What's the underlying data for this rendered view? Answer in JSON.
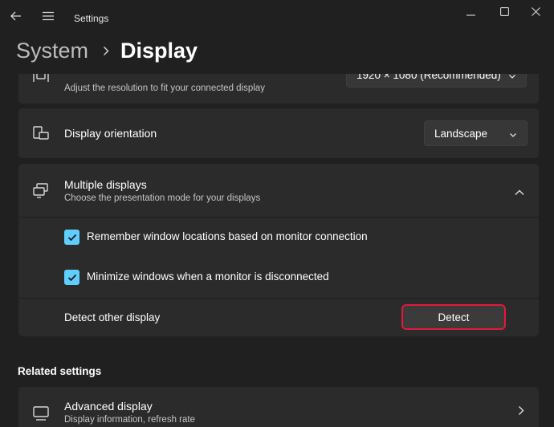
{
  "app": {
    "title": "Settings"
  },
  "breadcrumb": {
    "parent": "System",
    "current": "Display"
  },
  "resolution_row": {
    "subtitle": "Adjust the resolution to fit your connected display",
    "value": "1920 × 1080 (Recommended)"
  },
  "orientation_row": {
    "title": "Display orientation",
    "value": "Landscape"
  },
  "multiple_displays": {
    "title": "Multiple displays",
    "subtitle": "Choose the presentation mode for your displays",
    "remember_label": "Remember window locations based on monitor connection",
    "remember_checked": true,
    "minimize_label": "Minimize windows when a monitor is disconnected",
    "minimize_checked": true,
    "detect_label": "Detect other display",
    "detect_button": "Detect"
  },
  "related": {
    "heading": "Related settings",
    "advanced_title": "Advanced display",
    "advanced_subtitle": "Display information, refresh rate"
  },
  "colors": {
    "accent": "#60cdff",
    "highlight": "#e2183c",
    "card": "#2b2b2b",
    "background": "#202020"
  }
}
